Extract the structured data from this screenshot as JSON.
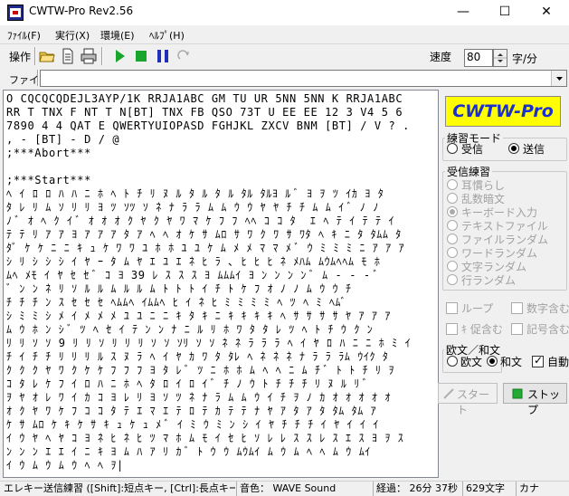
{
  "window": {
    "title": "CWTW-Pro Rev2.56",
    "minimize": "—",
    "maximize": "☐",
    "close": "✕"
  },
  "menu": [
    "ﾌｧｲﾙ(F)",
    "実行(X)",
    "環境(E)",
    "ﾍﾙﾌﾟ(H)"
  ],
  "toolbar": {
    "operate_label": "操作",
    "icons": [
      "open-folder-icon",
      "document-icon",
      "print-icon",
      "play-icon",
      "stop-icon",
      "pause-icon",
      "redo-icon"
    ],
    "speed_label": "速度",
    "speed_value": "80",
    "speed_unit": "字/分"
  },
  "file_row": {
    "label": "ファイル",
    "value": ""
  },
  "text_lines": [
    "O CQCQCQDEJL3AYP/1K RRJA1ABC GM TU UR 5NN 5NN K RRJA1ABC",
    "RR T TNX F NT T N[BT] TNX FB QSO 73T U EE EE 12 3 V4 5 6",
    "7890 4 4 QAT E QWERTYUIOPASD FGHJKL ZXCV BNM [BT] / V ? .",
    ", - [BT] - D / @",
    ";***Abort***",
    "",
    ";***Start***",
    "ﾍ ｲ ﾛ ﾛ ﾊ ﾊ ﾆ ﾎ ﾍ ﾄ ﾁ ﾘ ﾇ ﾙ ﾀ ﾙ ﾀ ﾙ ﾀﾙ ﾀﾙﾖ ﾙ ﾞ ﾖ ｦ ﾂ ｲｶ ﾖ ﾀ",
    "ﾀ ﾚ ﾘ ﾑ ｿ ﾘ ﾘ ﾖ ﾂ ｿﾂ ｿ ﾈ ﾅ ﾗ ﾗ ﾑ ﾑ ｳ ｳ ﾔ ﾔ ﾁ ﾁ ﾑ ﾑ ｲ ﾞ ﾉ ﾉ",
    "ﾉ ﾞ ｵ ﾍ ｸ ｲ ﾞ ｵ ｵ ｵ ｸ ﾔ ｸ ﾔ ﾜ ﾏ ｹ ﾌ ﾌ ﾍﾍ ｺ ｺ ﾀ  ｴ ﾍ ﾃ ｲ ﾃ ﾃ ｲ",
    "ﾃ ﾃ ﾘ ｱ ｱ ﾖ ｱ ｱ ｱ ﾀ ｱ ﾍ ﾍ ｵ ｹ ｻ ﾑﾛ ｻ ﾜ ｸ ﾜ ｻ ﾜﾀ ﾍ ｷ ﾆ ﾀ ﾀﾑﾑ ﾀ",
    "ﾀﾞ ｹ ｹ ﾆ ﾆ ｷ ｭ ｹ ﾜ ﾜ ﾕ ﾎ ﾎ ﾕ ﾕ ｹ ﾑ ﾒ ﾒ ﾏ ﾏ ﾒ ﾞ ｳ ﾐ ﾐ ﾐ ﾆ ｱ ｱ ｱ",
    "ｼ ﾘ ｼ ｼ ｼ ｲ ﾔ ｰ ﾀ ﾑ ﾔ ｴ ﾕ ｴ ﾈ ﾋ ﾗ ､ ﾋ ﾋ ﾋ ﾈ ﾒﾊﾑ ﾑｳﾑﾍﾍﾑ ﾓ ﾎ",
    "ﾑﾍ ﾒﾓ ｲ ﾔ ｾ ｾ ﾞ ｺ ﾖ 39 ﾚ ｽ ｽ ｽ ﾖ ﾑﾑﾑｲ ﾖ ﾝ ﾝ ﾝ ﾝ ﾞ ﾑ - - - ﾞ",
    "ﾞ ﾝ ﾝ ﾈ ﾘ ｿ ﾙ ﾙ ﾑ ﾙ ﾙ ﾑ ﾄ ﾄ ﾄ ｲ ﾁ ﾄ ｹ ﾌ ｵ ﾉ ﾉ ﾑ ｳ ｳ ﾁ",
    "ﾁ ﾁ ﾁ ﾝ ｽ ｾ ｾ ｾ ﾍﾑﾑﾍ ｲﾑﾑﾍ ﾋ ｲ ﾈ ﾋ ﾐ ﾐ ﾐ ﾐ ﾍ ﾂ ﾍ ﾐ ﾍﾑﾞ",
    "ｼ ﾐ ﾐ ｼ ﾒ ｲ ﾒ ﾒ ﾒ ﾕ ﾕ ﾆ ﾆ ｷ ﾀ ｷ ﾆ ｷ ｷ ｷ ｷ ﾍ ｻ ｻ ｻ ｻ ﾔ ｱ ｱ ｱ",
    "ﾑ ｳ ﾎ ﾝ ｼ ﾞ ﾂ ﾍ ｾ ｲ ﾃ ﾝ ﾝ ﾅ ﾆ ﾙ ﾘ ﾎ ﾜ ﾀ ﾀ ﾚ ﾂ ﾍ ﾄ ﾁ ｳ ｸ ﾝ",
    "ﾘ ﾘ ｿ ｿ 9 ﾘ ﾘ ｿ ﾘ ﾘ ﾘ ｿ ｿ ｿﾘ ｿ ｿ ﾈ ﾈ ﾗ ﾗ ﾗ ﾍ ｲ ﾔ ﾛ ﾊ ﾆ ﾆ ﾎ ﾐ ｲ",
    "ﾁ ｲ ﾁ ﾁ ﾘ ﾘ ﾘ ﾙ ｽ ﾇ ﾗ ﾍ ｲ ﾔ ｶ ﾜ ﾀ ﾀﾚ ﾍ ﾈ ﾈ ﾈ ﾅ ﾗ ﾗ ﾗﾑ ｳｲｸ ﾀ",
    "ｸ ｸ ｸ ﾔ ﾜ ｸ ｹ ｹ ﾌ ﾌ ﾌ ﾖ ﾀ ﾚ ﾞ ﾂ ﾆ ﾎ ﾎ ﾑ ﾍ ﾍ ﾆ ﾑ ﾁ ﾞ ﾄ ﾄ ﾁ ﾘ ｦ",
    "ｺ ﾀ ﾚ ｹ ﾌ ｲ ﾛ ﾊ ﾆ ﾎ ﾍ ﾀ ﾛ ｲ ﾛ ｲ ﾞ ﾁ ﾉ ｳ ﾄ ﾁ ﾁ ﾁ ﾘ ﾇ ﾙ ﾘ ﾞ",
    "ｦ ﾔ ｵ ﾚ ﾜ ｲ ｶ ｺ ﾖ ﾚ ﾘ ﾖ ｿ ﾂ ﾈ ﾅ ﾗ ﾑ ﾑ ｳ ｲ ﾁ ｦ ﾉ ｶ ｵ ｵ ｵ ｵ ｵ",
    "ｵ ｸ ﾔ ﾜ ｹ ﾌ ｺ ｺ ﾀ ﾃ ｴ ﾏ ｴ ﾃ ﾛ ﾃ ｶ ﾃ ﾃ ﾅ ﾔ ｱ ﾀ ｱ ﾀ ﾀﾑ ﾀﾑ ｱ",
    "ｹ ｻ ﾑﾛ ｹ ｷ ｹ ｻ ｷ ｭ ｹ ｭ ﾒ ﾞ ｲ ﾐ ｳ ﾐ ﾝ ｼ ｲ ﾔ ﾁ ﾁ ﾁ ｲ ﾔ ｲ ｲ ｲ",
    "ｲ ｳ ﾔ ﾍ ﾔ ｺ ﾖ ﾈ ﾋ ﾈ ﾋ ﾂ ﾏ ﾎ ﾑ ﾓ ｲ ｾ ﾋ ｿ ﾚ ﾚ ｽ ｽ ﾚ ｽ ｴ ｽ ﾖ ｦ ｽ",
    "ﾝ ﾝ ﾝ ｴ ｴ ｲ ﾆ ｷ ﾖ ﾑ ﾊ ｱ ﾘ ｶ ﾞ ﾄ ｳ ｳ ﾑｳﾑｲ ﾑ ｳ ﾑ ﾍ ﾍ ﾑ ｳ ﾑｲ",
    "ｲ ｳ ﾑ ｳ ﾑ ｳ ﾍ ﾍ ｦ|"
  ],
  "panel": {
    "logo": "CWTW-Pro",
    "practice_mode": {
      "title": "練習モード",
      "options": [
        "受信",
        "送信"
      ],
      "selected": 1
    },
    "receive_practice": {
      "title": "受信練習",
      "options": [
        "耳慣らし",
        "乱数暗文",
        "キーボード入力",
        "テキストファイル",
        "ファイルランダム",
        "ワードランダム",
        "文字ランダム",
        "行ランダム"
      ],
      "selected": 2
    },
    "checks": {
      "loop": "ループ",
      "include_digits": "数字含む",
      "include_half_kana": "ｷ 促含む",
      "include_symbols": "記号含む"
    },
    "euro_japanese": {
      "title": "欧文／和文",
      "options": [
        "欧文",
        "和文"
      ],
      "selected": 1,
      "auto_label": "自動",
      "auto_checked": true
    },
    "start_label": "スタート",
    "stop_label": "ストップ",
    "stop_color": "#22aa33",
    "logo_bg": "#ffff00",
    "logo_color": "#1a2fd0"
  },
  "status": {
    "mode": "エレキー送信練習 ([Shift]:短点キー, [Ctrl]:長点キー)",
    "sound": "音色： WAVE Sound",
    "elapsed": "経過： 26分 37秒",
    "chars": "629文字",
    "script": "カナ"
  }
}
